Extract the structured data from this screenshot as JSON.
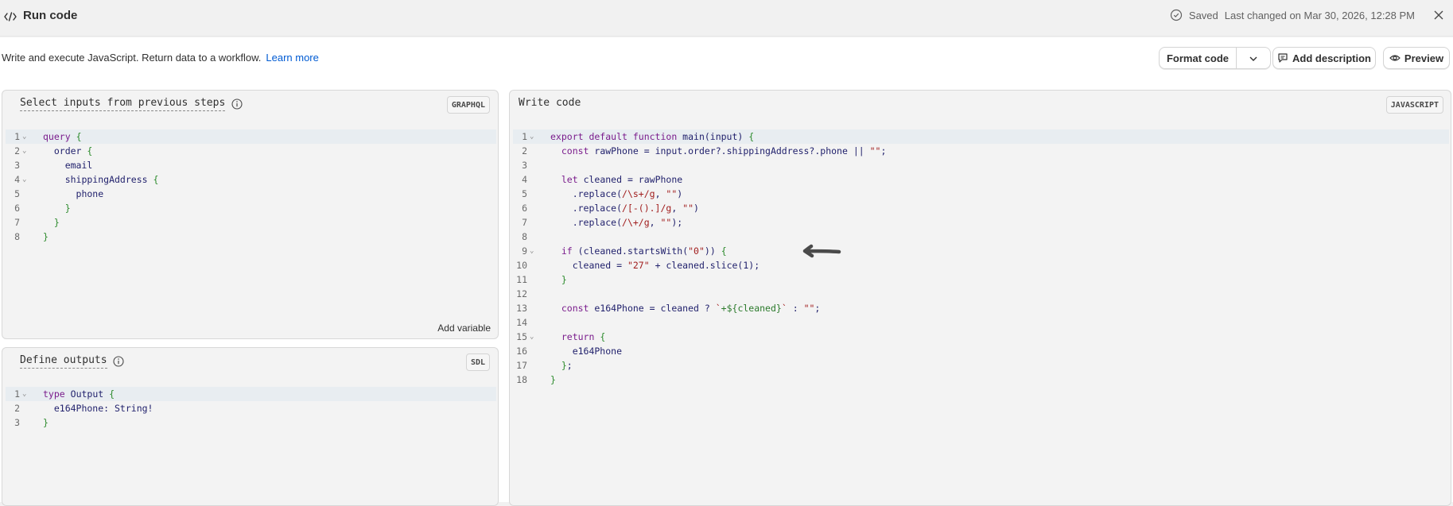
{
  "header": {
    "title": "Run code",
    "saved": "Saved",
    "last_changed": "Last changed on Mar 30, 2026, 12:28 PM"
  },
  "subheader": {
    "description": "Write and execute JavaScript. Return data to a workflow.",
    "learn_more": "Learn more",
    "format_code": "Format code",
    "add_description": "Add description",
    "preview": "Preview"
  },
  "inputs_panel": {
    "title": "Select inputs from previous steps",
    "badge": "GRAPHQL",
    "add_variable": "Add variable",
    "lines": [
      "query {",
      "  order {",
      "    email",
      "    shippingAddress {",
      "      phone",
      "    }",
      "  }",
      "}"
    ]
  },
  "outputs_panel": {
    "title": "Define outputs",
    "badge": "SDL",
    "lines": [
      "type Output {",
      "  e164Phone: String!",
      "}"
    ]
  },
  "code_panel": {
    "title": "Write code",
    "badge": "JAVASCRIPT",
    "lines": [
      "export default function main(input) {",
      "  const rawPhone = input.order?.shippingAddress?.phone || \"\";",
      "",
      "  let cleaned = rawPhone",
      "    .replace(/\\s+/g, \"\")",
      "    .replace(/[-().]/g, \"\")",
      "    .replace(/\\+/g, \"\");",
      "",
      "  if (cleaned.startsWith(\"0\")) {",
      "    cleaned = \"27\" + cleaned.slice(1);",
      "  }",
      "",
      "  const e164Phone = cleaned ? `+${cleaned}` : \"\";",
      "",
      "  return {",
      "    e164Phone",
      "  };",
      "}"
    ]
  },
  "colors": {
    "link": "#005bd3",
    "keyword": "#7a1c8c",
    "string": "#a11d1d",
    "bracket": "#2b8a2b",
    "active_line": "#e8edf1"
  }
}
